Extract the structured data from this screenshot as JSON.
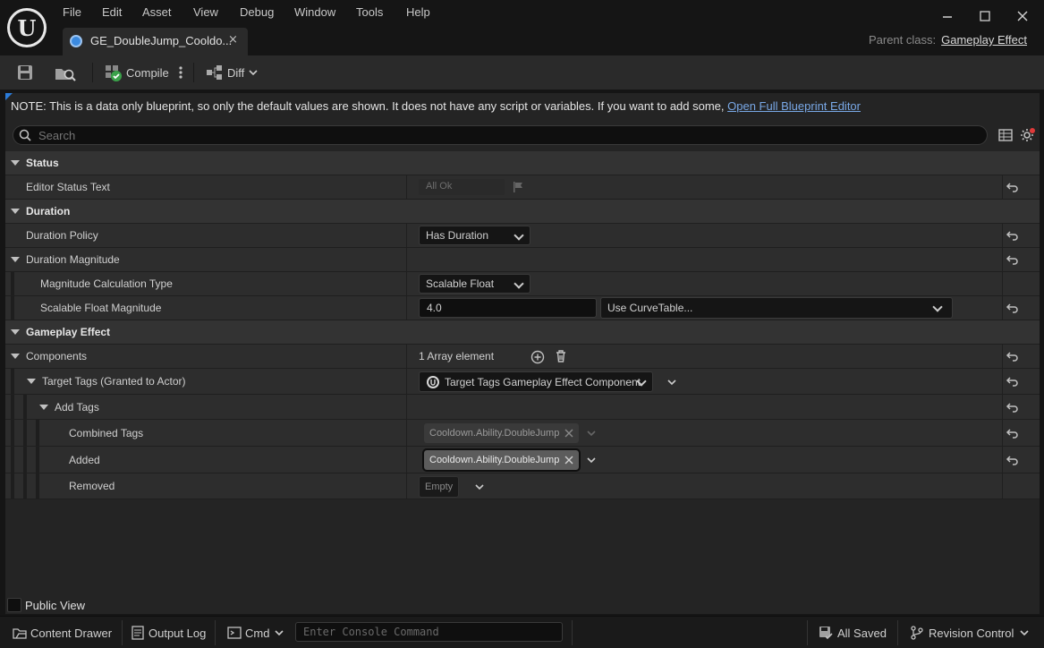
{
  "menu": [
    "File",
    "Edit",
    "Asset",
    "View",
    "Debug",
    "Window",
    "Tools",
    "Help"
  ],
  "tab": {
    "label": "GE_DoubleJump_Cooldo...",
    "close": "×"
  },
  "parent_class": {
    "label": "Parent class:",
    "value": "Gameplay Effect"
  },
  "toolbar": {
    "compile": "Compile",
    "diff": "Diff"
  },
  "note": {
    "text": "NOTE: This is a data only blueprint, so only the default values are shown.  It does not have any script or variables.  If you want to add some, ",
    "link": "Open Full Blueprint Editor"
  },
  "search": {
    "placeholder": "Search"
  },
  "details": {
    "status": "Status",
    "editor_status_text": "Editor Status Text",
    "editor_status_value": "All Ok",
    "duration": "Duration",
    "duration_policy": "Duration Policy",
    "duration_policy_value": "Has Duration",
    "duration_magnitude": "Duration Magnitude",
    "magnitude_calc_type": "Magnitude Calculation Type",
    "magnitude_calc_type_value": "Scalable Float",
    "scalable_float_magnitude": "Scalable Float Magnitude",
    "scalable_float_value": "4.0",
    "curve_table": "Use CurveTable...",
    "gameplay_effect": "Gameplay Effect",
    "components": "Components",
    "components_value": "1 Array element",
    "target_tags": "Target Tags (Granted to Actor)",
    "target_tags_value": "Target Tags Gameplay Effect Component",
    "add_tags": "Add Tags",
    "combined_tags": "Combined Tags",
    "combined_tag_value": "Cooldown.Ability.DoubleJump",
    "added": "Added",
    "added_tag_value": "Cooldown.Ability.DoubleJump",
    "removed": "Removed",
    "removed_value": "Empty"
  },
  "public_view": "Public View",
  "statusbar": {
    "content_drawer": "Content Drawer",
    "output_log": "Output Log",
    "cmd": "Cmd",
    "console_placeholder": "Enter Console Command",
    "all_saved": "All Saved",
    "revision_control": "Revision Control"
  }
}
